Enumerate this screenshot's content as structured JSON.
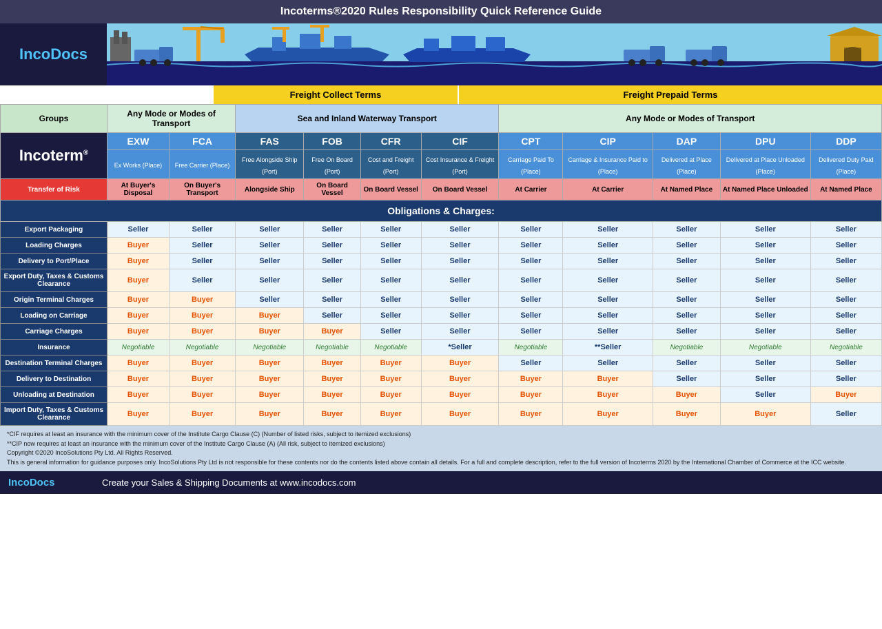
{
  "title": "Incoterms®2020 Rules Responsibility Quick Reference Guide",
  "logo": {
    "prefix": "Inco",
    "suffix": "Docs"
  },
  "freight_collect_label": "Freight Collect Terms",
  "freight_prepaid_label": "Freight Prepaid Terms",
  "groups": {
    "label": "Groups",
    "any_mode_1": "Any Mode or Modes of Transport",
    "sea_inland": "Sea and Inland Waterway Transport",
    "any_mode_2": "Any Mode or Modes of Transport"
  },
  "incoterm_label": "Incoterm®",
  "columns": [
    {
      "code": "EXW",
      "full": "Ex Works (Place)",
      "color": "any1"
    },
    {
      "code": "FCA",
      "full": "Free Carrier (Place)",
      "color": "any1"
    },
    {
      "code": "FAS",
      "full": "Free Alongside Ship (Port)",
      "color": "sea"
    },
    {
      "code": "FOB",
      "full": "Free On Board (Port)",
      "color": "sea"
    },
    {
      "code": "CFR",
      "full": "Cost and Freight (Port)",
      "color": "sea"
    },
    {
      "code": "CIF",
      "full": "Cost Insurance & Freight (Port)",
      "color": "sea"
    },
    {
      "code": "CPT",
      "full": "Carriage Paid To (Place)",
      "color": "any2"
    },
    {
      "code": "CIP",
      "full": "Carriage & Insurance Paid to (Place)",
      "color": "any2"
    },
    {
      "code": "DAP",
      "full": "Delivered at Place (Place)",
      "color": "any2"
    },
    {
      "code": "DPU",
      "full": "Delivered at Place Unloaded (Place)",
      "color": "any2"
    },
    {
      "code": "DDP",
      "full": "Delivered Duty Paid (Place)",
      "color": "any2"
    }
  ],
  "transfer_of_risk": {
    "label": "Transfer of Risk",
    "values": [
      "At Buyer's Disposal",
      "On Buyer's Transport",
      "Alongside Ship",
      "On Board Vessel",
      "On Board Vessel",
      "On Board Vessel",
      "At Carrier",
      "At Carrier",
      "At Named Place",
      "At Named Place Unloaded",
      "At Named Place"
    ]
  },
  "obligations_label": "Obligations & Charges:",
  "rows": [
    {
      "label": "Export Packaging",
      "values": [
        "Seller",
        "Seller",
        "Seller",
        "Seller",
        "Seller",
        "Seller",
        "Seller",
        "Seller",
        "Seller",
        "Seller",
        "Seller"
      ],
      "types": [
        "seller",
        "seller",
        "seller",
        "seller",
        "seller",
        "seller",
        "seller",
        "seller",
        "seller",
        "seller",
        "seller"
      ]
    },
    {
      "label": "Loading Charges",
      "values": [
        "Buyer",
        "Seller",
        "Seller",
        "Seller",
        "Seller",
        "Seller",
        "Seller",
        "Seller",
        "Seller",
        "Seller",
        "Seller"
      ],
      "types": [
        "buyer",
        "seller",
        "seller",
        "seller",
        "seller",
        "seller",
        "seller",
        "seller",
        "seller",
        "seller",
        "seller"
      ]
    },
    {
      "label": "Delivery to Port/Place",
      "values": [
        "Buyer",
        "Seller",
        "Seller",
        "Seller",
        "Seller",
        "Seller",
        "Seller",
        "Seller",
        "Seller",
        "Seller",
        "Seller"
      ],
      "types": [
        "buyer",
        "seller",
        "seller",
        "seller",
        "seller",
        "seller",
        "seller",
        "seller",
        "seller",
        "seller",
        "seller"
      ]
    },
    {
      "label": "Export Duty, Taxes & Customs Clearance",
      "values": [
        "Buyer",
        "Seller",
        "Seller",
        "Seller",
        "Seller",
        "Seller",
        "Seller",
        "Seller",
        "Seller",
        "Seller",
        "Seller"
      ],
      "types": [
        "buyer",
        "seller",
        "seller",
        "seller",
        "seller",
        "seller",
        "seller",
        "seller",
        "seller",
        "seller",
        "seller"
      ]
    },
    {
      "label": "Origin Terminal Charges",
      "values": [
        "Buyer",
        "Buyer",
        "Seller",
        "Seller",
        "Seller",
        "Seller",
        "Seller",
        "Seller",
        "Seller",
        "Seller",
        "Seller"
      ],
      "types": [
        "buyer",
        "buyer",
        "seller",
        "seller",
        "seller",
        "seller",
        "seller",
        "seller",
        "seller",
        "seller",
        "seller"
      ]
    },
    {
      "label": "Loading on Carriage",
      "values": [
        "Buyer",
        "Buyer",
        "Buyer",
        "Seller",
        "Seller",
        "Seller",
        "Seller",
        "Seller",
        "Seller",
        "Seller",
        "Seller"
      ],
      "types": [
        "buyer",
        "buyer",
        "buyer",
        "seller",
        "seller",
        "seller",
        "seller",
        "seller",
        "seller",
        "seller",
        "seller"
      ]
    },
    {
      "label": "Carriage Charges",
      "values": [
        "Buyer",
        "Buyer",
        "Buyer",
        "Buyer",
        "Seller",
        "Seller",
        "Seller",
        "Seller",
        "Seller",
        "Seller",
        "Seller"
      ],
      "types": [
        "buyer",
        "buyer",
        "buyer",
        "buyer",
        "seller",
        "seller",
        "seller",
        "seller",
        "seller",
        "seller",
        "seller"
      ]
    },
    {
      "label": "Insurance",
      "values": [
        "Negotiable",
        "Negotiable",
        "Negotiable",
        "Negotiable",
        "Negotiable",
        "*Seller",
        "Negotiable",
        "**Seller",
        "Negotiable",
        "Negotiable",
        "Negotiable"
      ],
      "types": [
        "negotiable",
        "negotiable",
        "negotiable",
        "negotiable",
        "negotiable",
        "seller-star",
        "negotiable",
        "seller-star",
        "negotiable",
        "negotiable",
        "negotiable"
      ]
    },
    {
      "label": "Destination Terminal Charges",
      "values": [
        "Buyer",
        "Buyer",
        "Buyer",
        "Buyer",
        "Buyer",
        "Buyer",
        "Seller",
        "Seller",
        "Seller",
        "Seller",
        "Seller"
      ],
      "types": [
        "buyer",
        "buyer",
        "buyer",
        "buyer",
        "buyer",
        "buyer",
        "seller",
        "seller",
        "seller",
        "seller",
        "seller"
      ]
    },
    {
      "label": "Delivery to Destination",
      "values": [
        "Buyer",
        "Buyer",
        "Buyer",
        "Buyer",
        "Buyer",
        "Buyer",
        "Buyer",
        "Buyer",
        "Seller",
        "Seller",
        "Seller"
      ],
      "types": [
        "buyer",
        "buyer",
        "buyer",
        "buyer",
        "buyer",
        "buyer",
        "buyer",
        "buyer",
        "seller",
        "seller",
        "seller"
      ]
    },
    {
      "label": "Unloading at Destination",
      "values": [
        "Buyer",
        "Buyer",
        "Buyer",
        "Buyer",
        "Buyer",
        "Buyer",
        "Buyer",
        "Buyer",
        "Buyer",
        "Seller",
        "Buyer"
      ],
      "types": [
        "buyer",
        "buyer",
        "buyer",
        "buyer",
        "buyer",
        "buyer",
        "buyer",
        "buyer",
        "buyer",
        "seller",
        "buyer"
      ]
    },
    {
      "label": "Import Duty, Taxes & Customs Clearance",
      "values": [
        "Buyer",
        "Buyer",
        "Buyer",
        "Buyer",
        "Buyer",
        "Buyer",
        "Buyer",
        "Buyer",
        "Buyer",
        "Buyer",
        "Seller"
      ],
      "types": [
        "buyer",
        "buyer",
        "buyer",
        "buyer",
        "buyer",
        "buyer",
        "buyer",
        "buyer",
        "buyer",
        "buyer",
        "seller"
      ]
    }
  ],
  "footer": {
    "logo_prefix": "Inco",
    "logo_suffix": "Docs",
    "tagline": "Create your Sales & Shipping Documents at www.incodocs.com",
    "notes": [
      "*CIF requires at least an insurance with the minimum cover of the Institute Cargo Clause (C) (Number of listed risks, subject to itemized exclusions)",
      "**CIP now requires at least an insurance with the minimum cover of the Institute Cargo Clause (A) (All risk, subject to itemized exclusions)",
      "Copyright ©2020 IncoSolutions Pty Ltd. All Rights Reserved.",
      "This is general information for guidance purposes only. IncoSolutions Pty Ltd is not responsible for these contents nor do the contents listed above contain all details. For a full and complete description, refer to the full version of Incoterms 2020 by the International Chamber of Commerce at the ICC website."
    ]
  }
}
